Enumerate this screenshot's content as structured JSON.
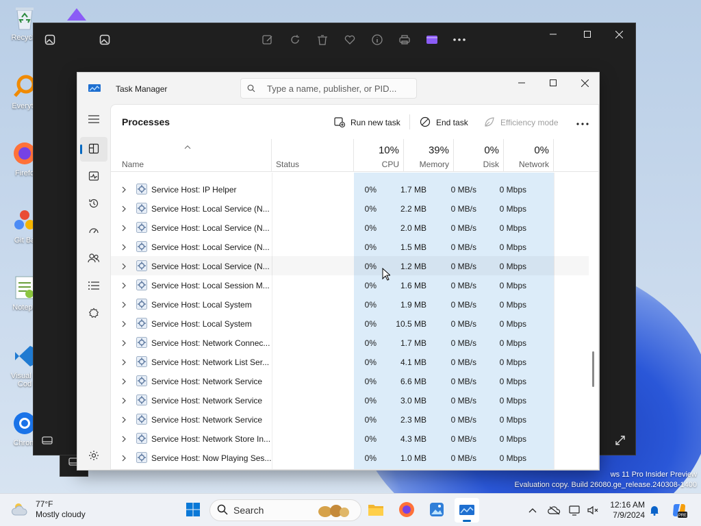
{
  "desktop": {
    "icons": [
      {
        "label": "Recycle",
        "icon": "recycle-bin-icon"
      },
      {
        "label": "Everyth",
        "icon": "everything-search-icon"
      },
      {
        "label": "Firefo",
        "icon": "firefox-icon"
      },
      {
        "label": "Git Ba",
        "icon": "git-bash-icon"
      },
      {
        "label": "Notepa",
        "icon": "notepad-plus-plus-icon"
      },
      {
        "label": "Visual S",
        "label2": "Cod",
        "icon": "vscode-icon"
      },
      {
        "label": "Chrom",
        "icon": "chrome-icon"
      }
    ],
    "watermark_line1": "ws 11 Pro Insider Preview",
    "watermark_line2": "Evaluation copy. Build 26080.ge_release.240308-1400"
  },
  "task_manager": {
    "title": "Task Manager",
    "search_placeholder": "Type a name, publisher, or PID...",
    "page_title": "Processes",
    "commands": {
      "run_new_task": "Run new task",
      "end_task": "End task",
      "efficiency_mode": "Efficiency mode"
    },
    "columns": {
      "name": "Name",
      "status": "Status",
      "cpu": {
        "label": "CPU",
        "pct": "10%"
      },
      "memory": {
        "label": "Memory",
        "pct": "39%"
      },
      "disk": {
        "label": "Disk",
        "pct": "0%"
      },
      "network": {
        "label": "Network",
        "pct": "0%"
      }
    },
    "nav_icons": [
      "processes-icon",
      "performance-icon",
      "app-history-icon",
      "startup-apps-icon",
      "users-icon",
      "details-icon",
      "services-icon",
      "settings-icon"
    ],
    "rows": [
      {
        "name": "Service Host: IP Helper",
        "cpu": "0%",
        "memory": "1.7 MB",
        "disk": "0 MB/s",
        "network": "0 Mbps"
      },
      {
        "name": "Service Host: Local Service (N...",
        "cpu": "0%",
        "memory": "2.2 MB",
        "disk": "0 MB/s",
        "network": "0 Mbps"
      },
      {
        "name": "Service Host: Local Service (N...",
        "cpu": "0%",
        "memory": "2.0 MB",
        "disk": "0 MB/s",
        "network": "0 Mbps"
      },
      {
        "name": "Service Host: Local Service (N...",
        "cpu": "0%",
        "memory": "1.5 MB",
        "disk": "0 MB/s",
        "network": "0 Mbps"
      },
      {
        "name": "Service Host: Local Service (N...",
        "cpu": "0%",
        "memory": "1.2 MB",
        "disk": "0 MB/s",
        "network": "0 Mbps"
      },
      {
        "name": "Service Host: Local Session M...",
        "cpu": "0%",
        "memory": "1.6 MB",
        "disk": "0 MB/s",
        "network": "0 Mbps"
      },
      {
        "name": "Service Host: Local System",
        "cpu": "0%",
        "memory": "1.9 MB",
        "disk": "0 MB/s",
        "network": "0 Mbps"
      },
      {
        "name": "Service Host: Local System",
        "cpu": "0%",
        "memory": "10.5 MB",
        "disk": "0 MB/s",
        "network": "0 Mbps"
      },
      {
        "name": "Service Host: Network Connec...",
        "cpu": "0%",
        "memory": "1.7 MB",
        "disk": "0 MB/s",
        "network": "0 Mbps"
      },
      {
        "name": "Service Host: Network List Ser...",
        "cpu": "0%",
        "memory": "4.1 MB",
        "disk": "0 MB/s",
        "network": "0 Mbps"
      },
      {
        "name": "Service Host: Network Service",
        "cpu": "0%",
        "memory": "6.6 MB",
        "disk": "0 MB/s",
        "network": "0 Mbps"
      },
      {
        "name": "Service Host: Network Service",
        "cpu": "0%",
        "memory": "3.0 MB",
        "disk": "0 MB/s",
        "network": "0 Mbps"
      },
      {
        "name": "Service Host: Network Service",
        "cpu": "0%",
        "memory": "2.3 MB",
        "disk": "0 MB/s",
        "network": "0 Mbps"
      },
      {
        "name": "Service Host: Network Store In...",
        "cpu": "0%",
        "memory": "4.3 MB",
        "disk": "0 MB/s",
        "network": "0 Mbps"
      },
      {
        "name": "Service Host: Now Playing Ses...",
        "cpu": "0%",
        "memory": "1.0 MB",
        "disk": "0 MB/s",
        "network": "0 Mbps"
      }
    ]
  },
  "taskbar": {
    "weather_temp": "77°F",
    "weather_desc": "Mostly cloudy",
    "search_label": "Search",
    "time": "12:16 AM",
    "date": "7/9/2024"
  },
  "colors": {
    "accent": "#0067c0",
    "highlight_column": "#dcecf9"
  }
}
